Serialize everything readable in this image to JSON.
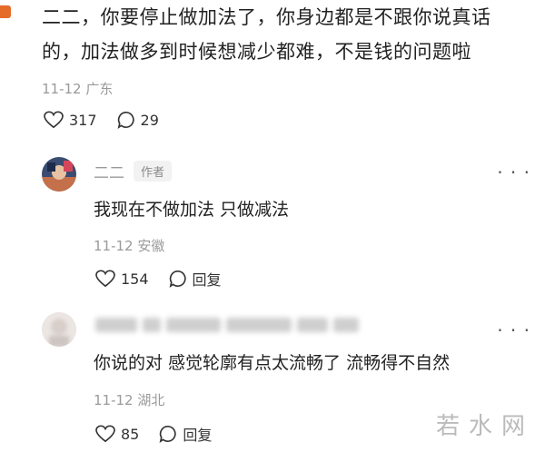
{
  "top_comment": {
    "text_line1": "二二，你要停止做加法了，你身边都是不跟你说真话",
    "text_line2": "的，加法做多到时候想减少都难，不是钱的问题啦",
    "date": "11-12",
    "location": "广东",
    "likes": "317",
    "replies": "29"
  },
  "reply1": {
    "name": "二二",
    "tag": "作者",
    "text": "我现在不做加法 只做减法",
    "date": "11-12",
    "location": "安徽",
    "likes": "154",
    "reply_label": "回复"
  },
  "reply2": {
    "text": "你说的对 感觉轮廓有点太流畅了 流畅得不自然",
    "date": "11-12",
    "location": "湖北",
    "likes": "85",
    "reply_label": "回复"
  },
  "watermark": "若水网",
  "colors": {
    "accent_corner": "#e46b2a",
    "meta_gray": "#9a9a9a"
  },
  "icons": [
    "heart-icon",
    "chat-bubble-icon",
    "more-dots-icon"
  ]
}
